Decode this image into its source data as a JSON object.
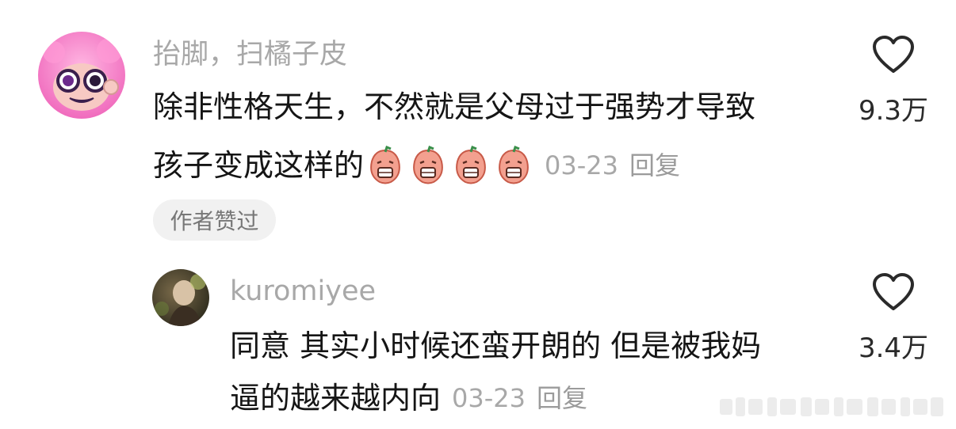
{
  "main_comment": {
    "username": "抬脚，扫橘子皮",
    "text_line1": "除非性格天生，不然就是父母过于强势才导致",
    "text_line2": "孩子变成这样的",
    "emoji_name": "crying-peach-emoji",
    "date": "03-23",
    "reply_label": "回复",
    "liked_tag": "作者赞过",
    "likes": "9.3万"
  },
  "reply_comment": {
    "username": "kuromiyee",
    "text_line1": "同意 其实小时候还蛮开朗的 但是被我妈",
    "text_line2": "逼的越来越内向",
    "date": "03-23",
    "reply_label": "回复",
    "likes": "3.4万"
  },
  "icons": {
    "heart": "heart-outline-icon"
  },
  "colors": {
    "meta_gray": "#a8a8a8",
    "tag_bg": "#f1f1f1",
    "avatar_pink": "#f18ac4"
  }
}
